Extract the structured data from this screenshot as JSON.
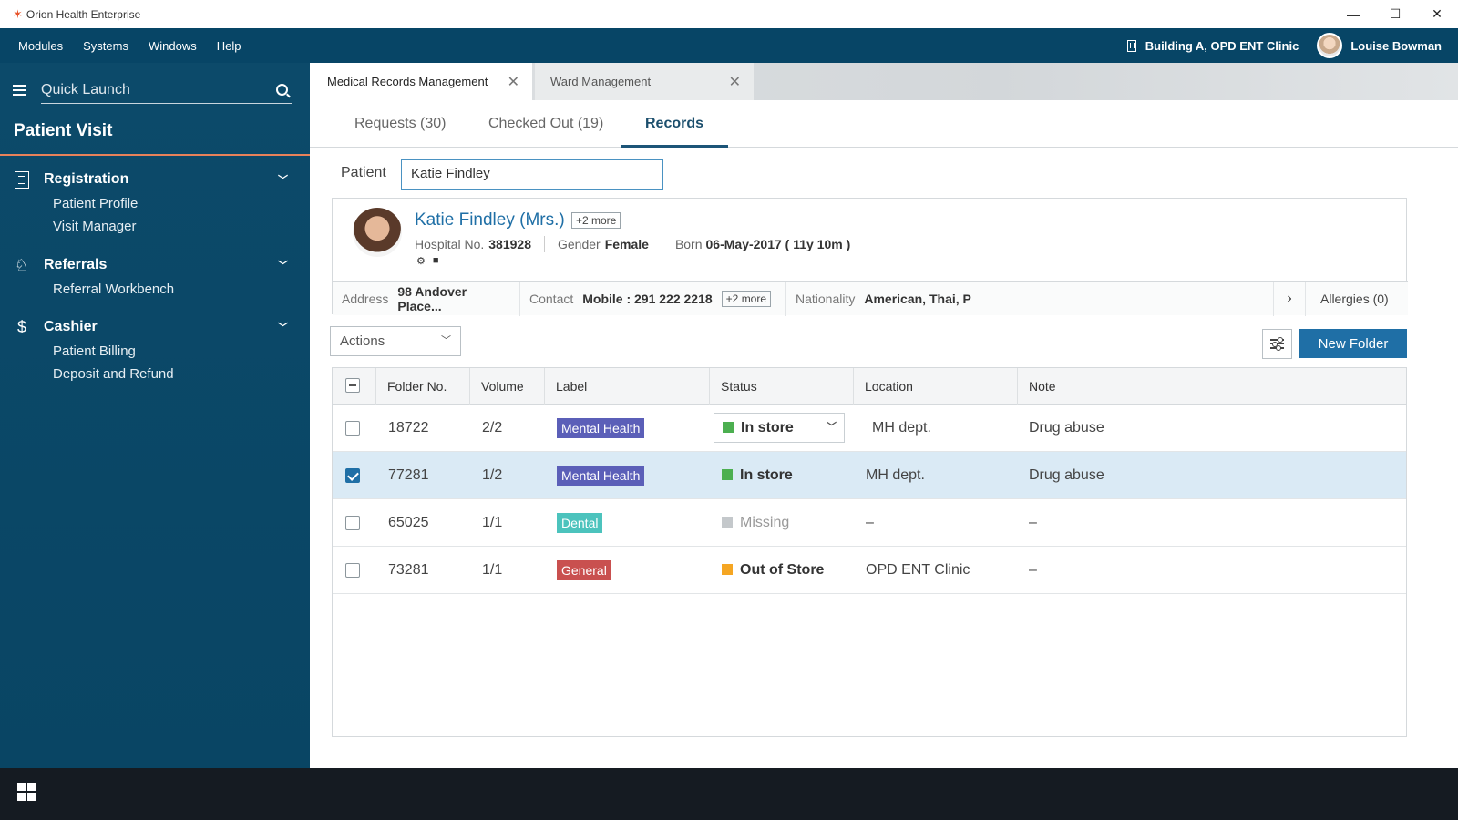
{
  "window": {
    "title": "Orion Health Enterprise"
  },
  "menubar": {
    "items": [
      "Modules",
      "Systems",
      "Windows",
      "Help"
    ],
    "location": "Building A, OPD ENT Clinic",
    "user": "Louise Bowman"
  },
  "sidebar": {
    "search_placeholder": "Quick Launch",
    "section": "Patient Visit",
    "groups": [
      {
        "label": "Registration",
        "icon": "document-icon",
        "items": [
          "Patient Profile",
          "Visit Manager"
        ]
      },
      {
        "label": "Referrals",
        "icon": "referral-icon",
        "items": [
          "Referral Workbench"
        ]
      },
      {
        "label": "Cashier",
        "icon": "dollar-icon",
        "items": [
          "Patient Billing",
          "Deposit and Refund"
        ]
      }
    ]
  },
  "tabs": {
    "documents": [
      "Medical Records Management",
      "Ward Management"
    ],
    "subtabs": [
      "Requests (30)",
      "Checked Out (19)",
      "Records"
    ],
    "active_subtab": "Records"
  },
  "patient_search": {
    "label": "Patient",
    "value": "Katie Findley"
  },
  "patient": {
    "name": "Katie Findley (Mrs.)",
    "more_names": "+2 more",
    "hospital_no_label": "Hospital No.",
    "hospital_no": "381928",
    "gender_label": "Gender",
    "gender": "Female",
    "born_label": "Born",
    "born": "06-May-2017 ( 11y 10m )",
    "address_label": "Address",
    "address": "98 Andover Place...",
    "contact_label": "Contact",
    "contact": "Mobile : 291 222 2218",
    "more_contacts": "+2 more",
    "nationality_label": "Nationality",
    "nationality": "American, Thai, P",
    "allergies": "Allergies (0)"
  },
  "toolbar": {
    "actions": "Actions",
    "new_folder": "New Folder"
  },
  "table": {
    "columns": [
      "Folder No.",
      "Volume",
      "Label",
      "Status",
      "Location",
      "Note"
    ],
    "rows": [
      {
        "folder": "18722",
        "volume": "2/2",
        "label": "Mental Health",
        "label_color": "#5b5fb8",
        "status": "In store",
        "status_color": "#4caf50",
        "location": "MH dept.",
        "note": "Drug abuse",
        "checked": false
      },
      {
        "folder": "77281",
        "volume": "1/2",
        "label": "Mental Health",
        "label_color": "#5b5fb8",
        "status": "In store",
        "status_color": "#4caf50",
        "location": "MH dept.",
        "note": "Drug abuse",
        "checked": true
      },
      {
        "folder": "65025",
        "volume": "1/1",
        "label": "Dental",
        "label_color": "#4cc3bd",
        "status": "Missing",
        "status_color": "#c4c8cb",
        "location": "–",
        "note": "–",
        "checked": false
      },
      {
        "folder": "73281",
        "volume": "1/1",
        "label": "General",
        "label_color": "#c9504f",
        "status": "Out of Store",
        "status_color": "#f5a623",
        "location": "OPD ENT Clinic",
        "note": "–",
        "checked": false
      }
    ]
  }
}
